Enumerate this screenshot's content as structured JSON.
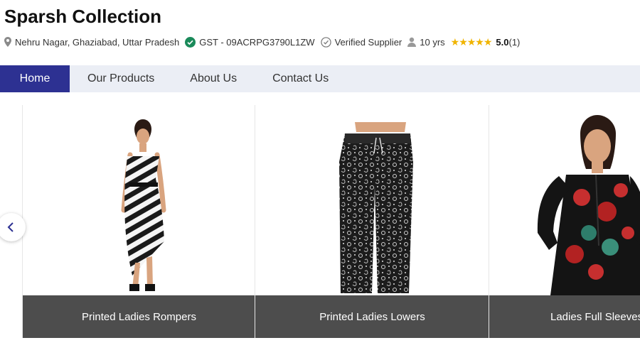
{
  "company": {
    "name": "Sparsh Collection",
    "location": "Nehru Nagar, Ghaziabad, Uttar Pradesh",
    "gst": "GST - 09ACRPG3790L1ZW",
    "verified": "Verified Supplier",
    "years": "10 yrs",
    "stars": "★★★★★",
    "rating": "5.0",
    "rating_count": "(1)"
  },
  "nav": [
    {
      "label": "Home",
      "active": true
    },
    {
      "label": "Our Products"
    },
    {
      "label": "About Us"
    },
    {
      "label": "Contact Us"
    }
  ],
  "products": [
    {
      "name": "Printed Ladies Rompers"
    },
    {
      "name": "Printed Ladies Lowers"
    },
    {
      "name": "Ladies Full Sleeves T"
    }
  ],
  "colors": {
    "nav_active": "#2d3192",
    "nav_bg": "#ebeef5",
    "caption_bg": "#4d4d4d",
    "star": "#f0b400",
    "verified_badge": "#1a8a5a"
  },
  "icons": {
    "location": "map-pin-icon",
    "gst": "check-circle-icon",
    "verified": "verified-badge-icon",
    "years": "user-icon",
    "prev": "chevron-left-icon"
  }
}
